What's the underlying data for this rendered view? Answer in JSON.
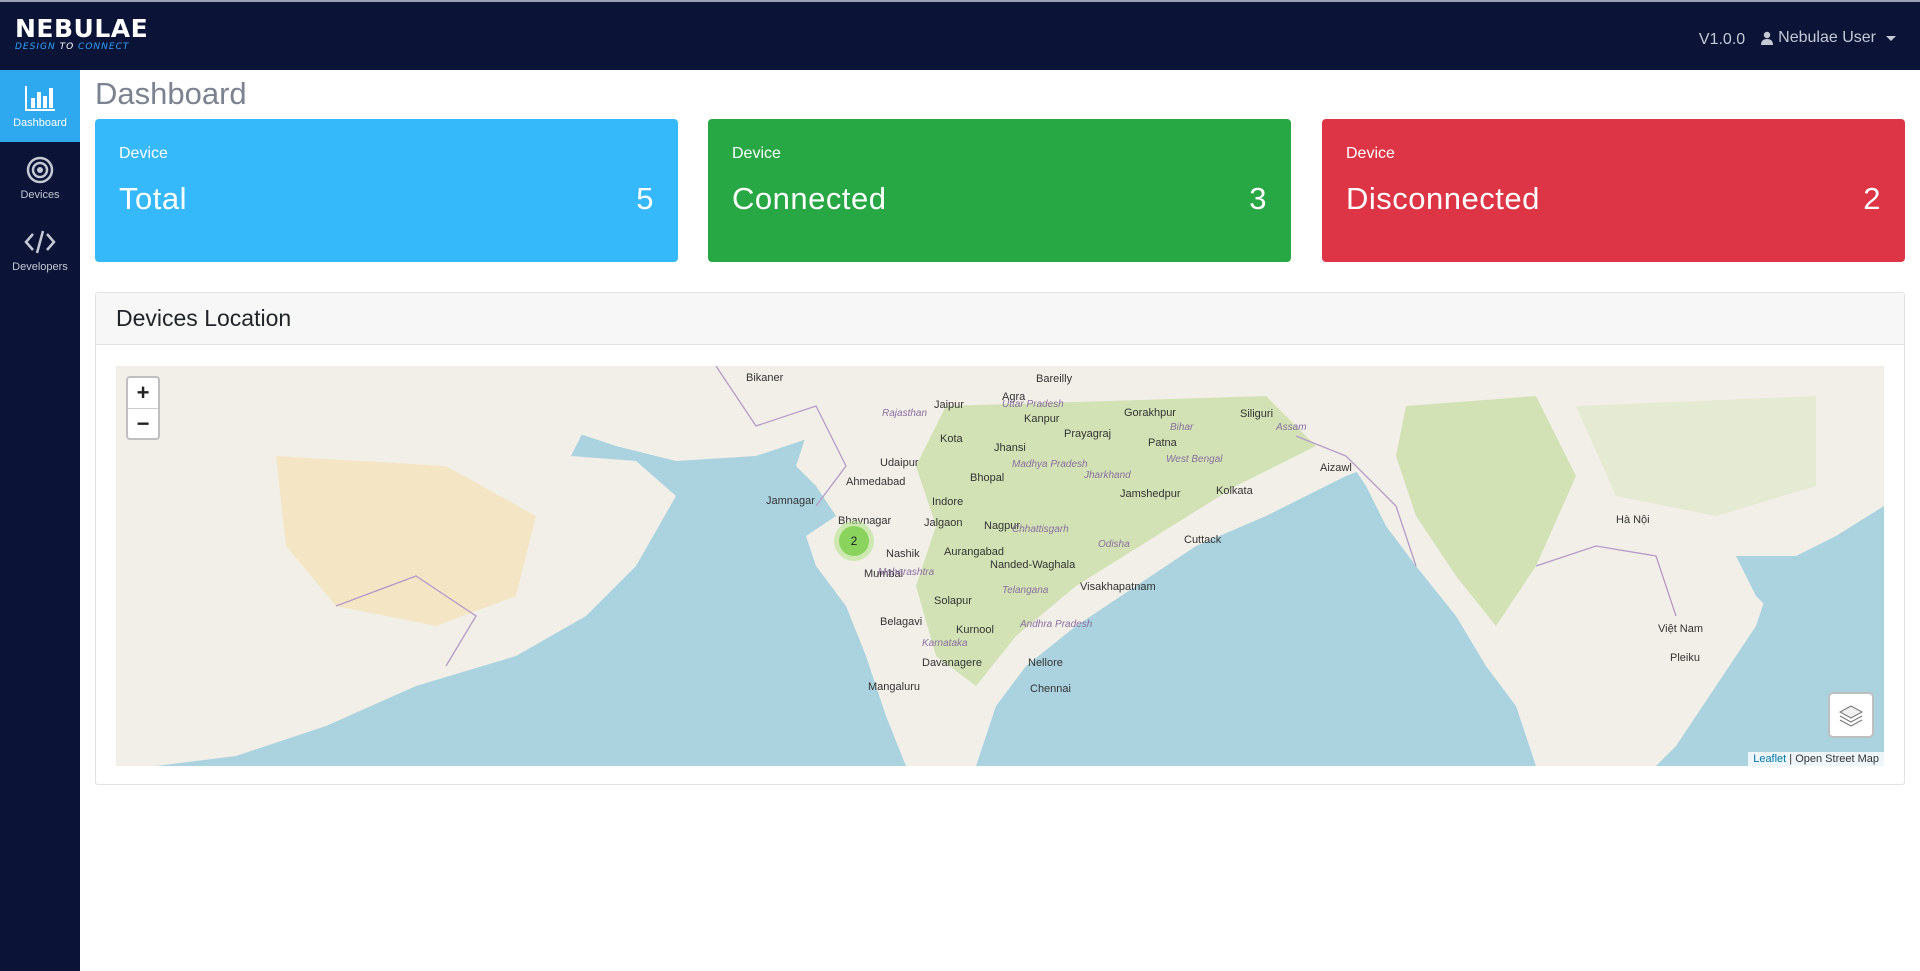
{
  "app": {
    "logo_name": "NEBULAE",
    "logo_tag_a": "DESIGN",
    "logo_tag_b": "TO",
    "logo_tag_c": "CONNECT",
    "version": "V1.0.0",
    "user_name": "Nebulae User"
  },
  "sidebar": {
    "items": [
      {
        "label": "Dashboard",
        "icon": "bar-chart-icon"
      },
      {
        "label": "Devices",
        "icon": "target-icon"
      },
      {
        "label": "Developers",
        "icon": "code-icon"
      }
    ]
  },
  "page": {
    "title": "Dashboard"
  },
  "cards": [
    {
      "small": "Device",
      "label": "Total",
      "value": "5",
      "color": "#36b9fb"
    },
    {
      "small": "Device",
      "label": "Connected",
      "value": "3",
      "color": "#28a745"
    },
    {
      "small": "Device",
      "label": "Disconnected",
      "value": "2",
      "color": "#dd3545"
    }
  ],
  "map_panel": {
    "title": "Devices Location",
    "zoom_in": "+",
    "zoom_out": "−",
    "cluster_count": "2",
    "attribution_link": "Leaflet",
    "attribution_sep": " | ",
    "attribution_text": "Open Street Map",
    "labels": [
      "Bikaner",
      "Jaipur",
      "Agra",
      "Bareilly",
      "Kanpur",
      "Prayagraj",
      "Gorakhpur",
      "Patna",
      "Siliguri",
      "Kota",
      "Jhansi",
      "Udaipur",
      "Ahmedabad",
      "Bhopal",
      "Jamnagar",
      "Indore",
      "Bhavnagar",
      "Jalgaon",
      "Nagpur",
      "Jamshedpur",
      "Kolkata",
      "Aizawl",
      "Cuttack",
      "Nashik",
      "Aurangabad",
      "Mumbai",
      "Nanded-Waghala",
      "Visakhapatnam",
      "Solapur",
      "Belagavi",
      "Kurnool",
      "Davanagere",
      "Nellore",
      "Mangaluru",
      "Chennai",
      "Hà Nội",
      "Việt Nam",
      "Pleiku",
      "Rajasthan",
      "Uttar Pradesh",
      "Madhya Pradesh",
      "Jharkhand",
      "West Bengal",
      "Bihar",
      "Chhattisgarh",
      "Odisha",
      "Maharashtra",
      "Telangana",
      "Andhra Pradesh",
      "Karnataka",
      "Assam"
    ]
  }
}
